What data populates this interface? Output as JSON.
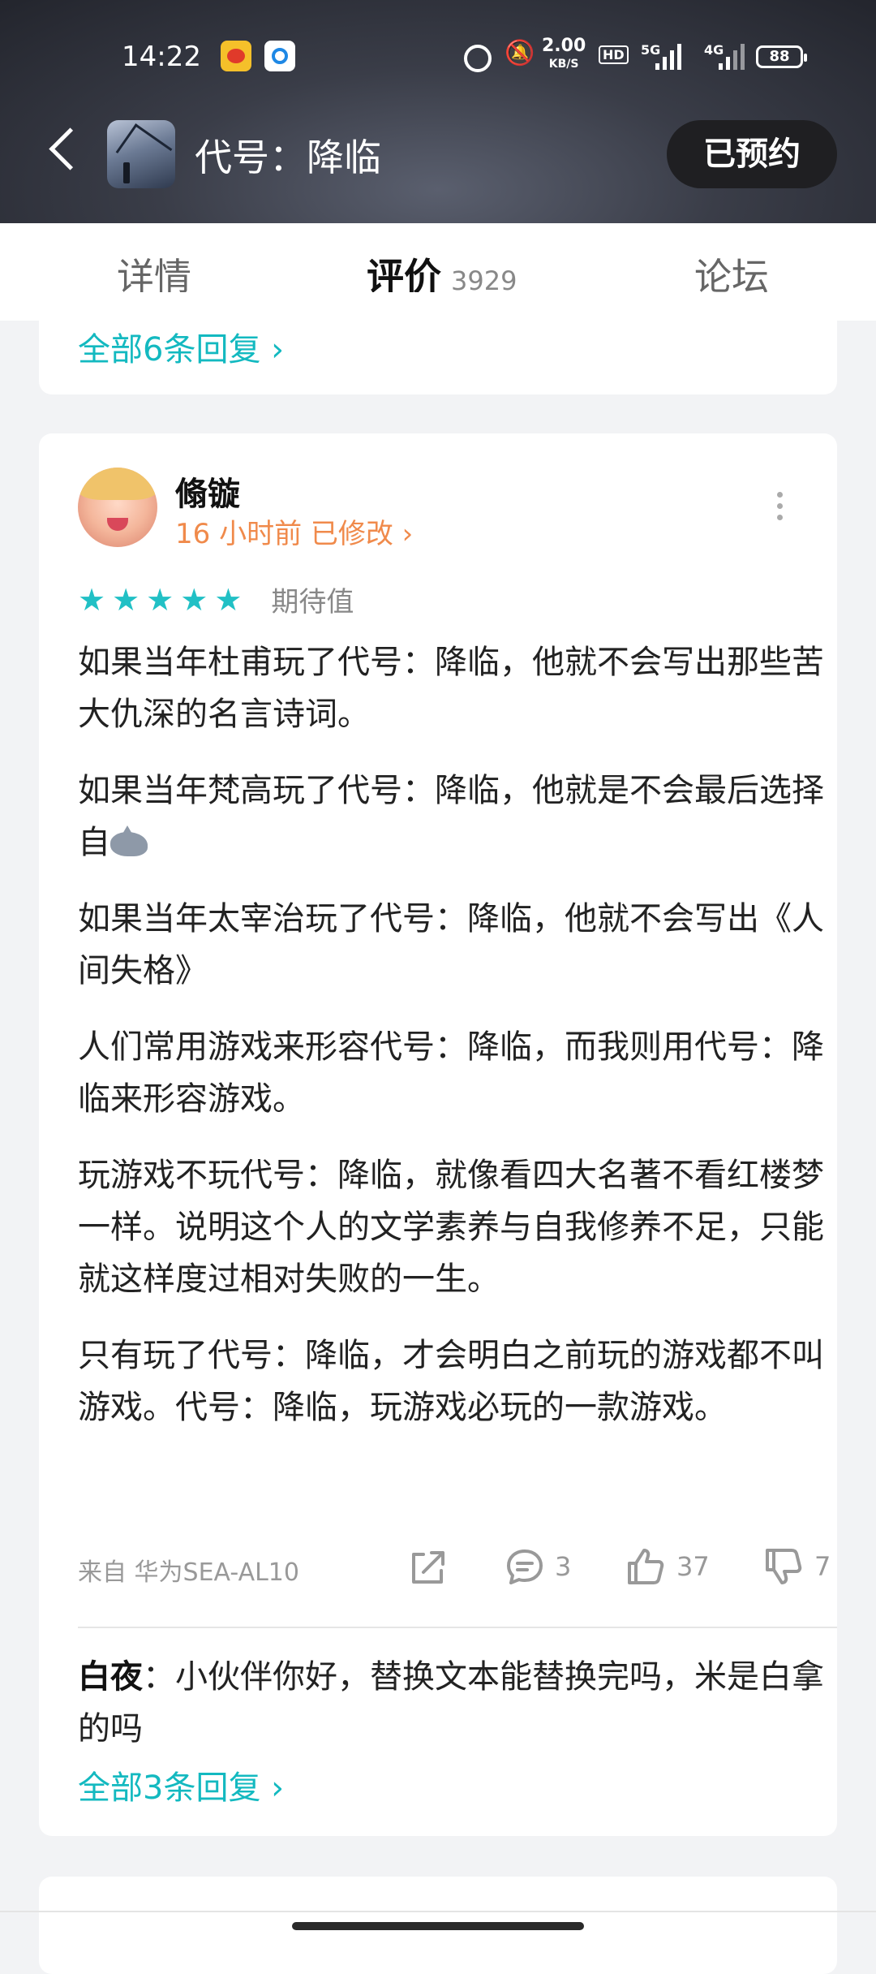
{
  "status_bar": {
    "time": "14:22",
    "net_speed": "2.00",
    "net_unit": "KB/S",
    "hd": "HD",
    "sim1": "5G",
    "sim2": "4G",
    "battery": "88"
  },
  "header": {
    "back_icon": "chevron-left-icon",
    "title": "代号：降临",
    "reserve_button": "已预约"
  },
  "tabs": {
    "details": "详情",
    "reviews": "评价",
    "reviews_count": "3929",
    "forum": "论坛",
    "active": "reviews"
  },
  "previous_card": {
    "replies_link": "全部6条回复 ›"
  },
  "review": {
    "username": "翛镟",
    "meta": "16 小时前 已修改 ›",
    "stars": 5,
    "rating_label": "期待值",
    "paragraphs": [
      "如果当年杜甫玩了代号：降临，他就不会写出那些苦大仇深的名言诗词。",
      "如果当年梵高玩了代号：降临，他就是不会最后选择自",
      "如果当年太宰治玩了代号：降临，他就不会写出《人间失格》",
      "人们常用游戏来形容代号：降临，而我则用代号：降临来形容游戏。",
      "玩游戏不玩代号：降临，就像看四大名著不看红楼梦一样。说明这个人的文学素养与自我修养不足，只能就这样度过相对失败的一生。",
      "只有玩了代号：降临，才会明白之前玩的游戏都不叫游戏。代号：降临，玩游戏必玩的一款游戏。"
    ],
    "source": "来自 华为SEA-AL10",
    "comment_count": "3",
    "like_count": "37",
    "dislike_count": "7",
    "reply_author": "白夜",
    "reply_text": "：小伙伴你好，替换文本能替换完吗，米是白拿的吗",
    "replies_link": "全部3条回复 ›"
  },
  "colors": {
    "accent": "#21c0c5",
    "link": "#13b9c0",
    "meta": "#f08a4b"
  }
}
